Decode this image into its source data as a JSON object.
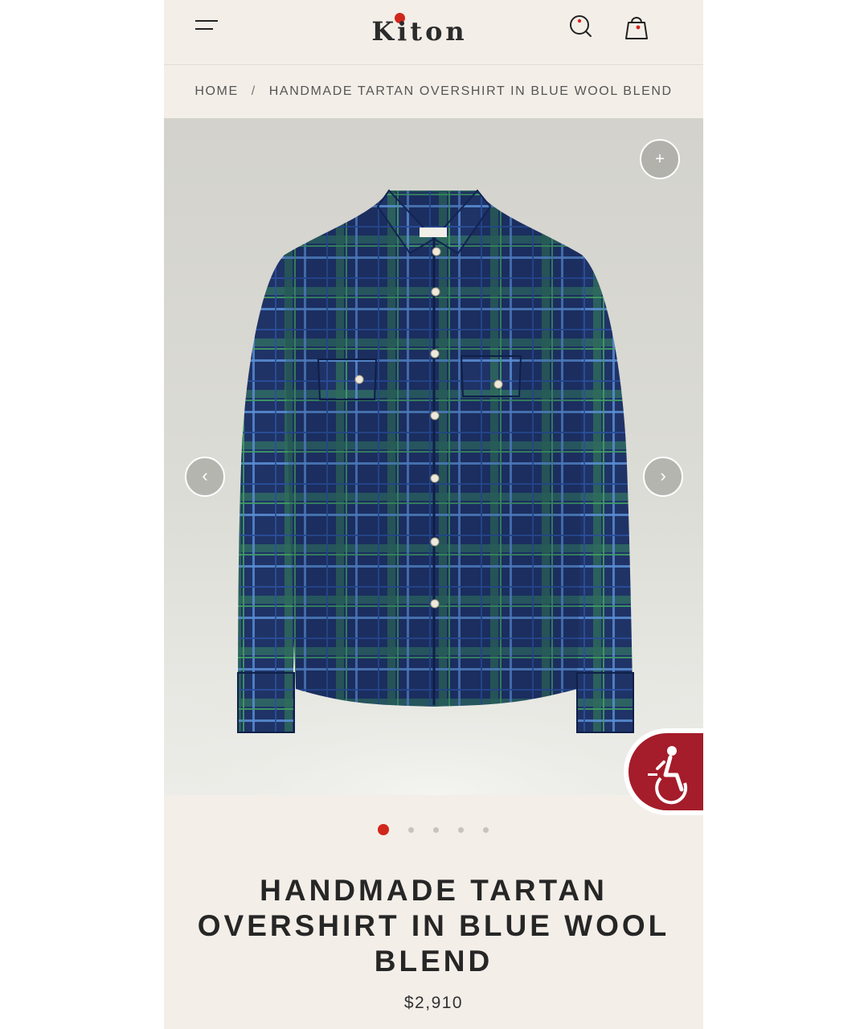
{
  "header": {
    "logo_text": "Kiton",
    "menu_icon": "hamburger-menu-icon",
    "search_icon": "search-icon",
    "bag_icon": "shopping-bag-icon"
  },
  "breadcrumb": {
    "home": "HOME",
    "separator": "/",
    "current": "HANDMADE TARTAN OVERSHIRT IN BLUE WOOL BLEND"
  },
  "gallery": {
    "zoom_label": "+",
    "prev_label": "‹",
    "next_label": "›",
    "image_count": 5,
    "active_index": 0
  },
  "product": {
    "title": "HANDMADE TARTAN OVERSHIRT IN BLUE WOOL BLEND",
    "price": "$2,910"
  },
  "colors": {
    "brand_red": "#d1261c",
    "accessibility_red": "#a51c2a",
    "background": "#f3eee8",
    "shirt_navy": "#1f3a6e",
    "shirt_green": "#2e7d4f"
  }
}
